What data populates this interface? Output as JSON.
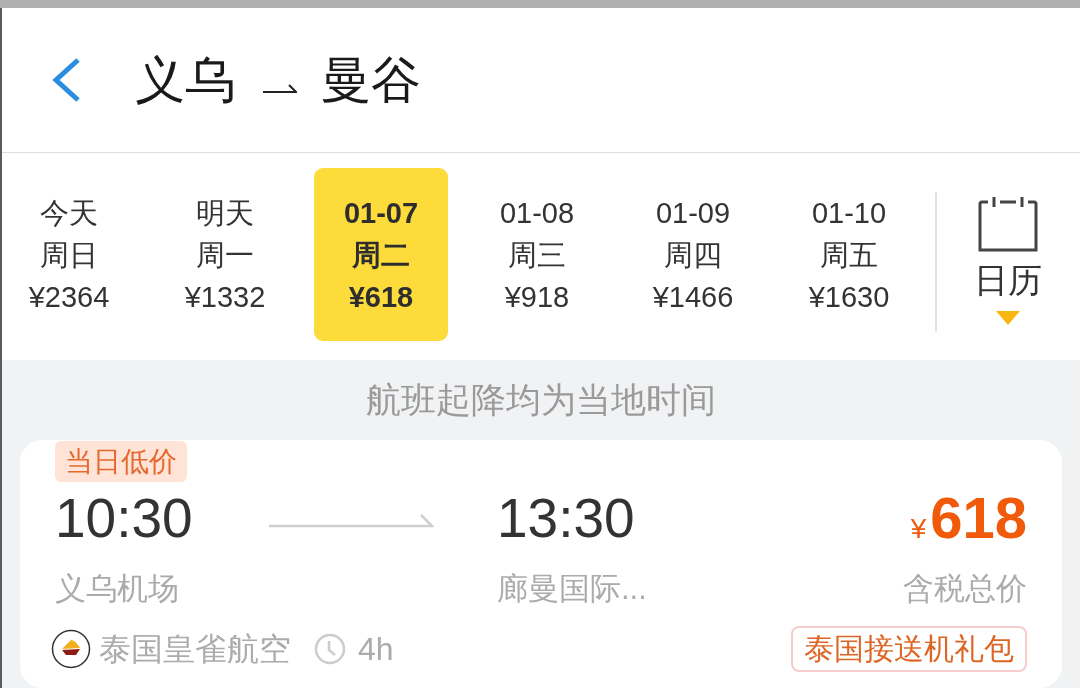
{
  "header": {
    "from": "义乌",
    "to": "曼谷"
  },
  "date_strip": {
    "dates": [
      {
        "day": "今天",
        "weekday": "周日",
        "price": "¥2364",
        "selected": false
      },
      {
        "day": "明天",
        "weekday": "周一",
        "price": "¥1332",
        "selected": false
      },
      {
        "day": "01-07",
        "weekday": "周二",
        "price": "¥618",
        "selected": true
      },
      {
        "day": "01-08",
        "weekday": "周三",
        "price": "¥918",
        "selected": false
      },
      {
        "day": "01-09",
        "weekday": "周四",
        "price": "¥1466",
        "selected": false
      },
      {
        "day": "01-10",
        "weekday": "周五",
        "price": "¥1630",
        "selected": false
      }
    ],
    "calendar": {
      "label": "日历"
    }
  },
  "notice": "航班起降均为当地时间",
  "flights": [
    {
      "tag": "当日低价",
      "depart_time": "10:30",
      "depart_airport": "义乌机场",
      "arrive_time": "13:30",
      "arrive_airport": "廊曼国际...",
      "currency": "¥",
      "price": "618",
      "price_note": "含税总价",
      "airline": "泰国皇雀航空",
      "duration": "4h",
      "promo": "泰国接送机礼包"
    }
  ]
}
